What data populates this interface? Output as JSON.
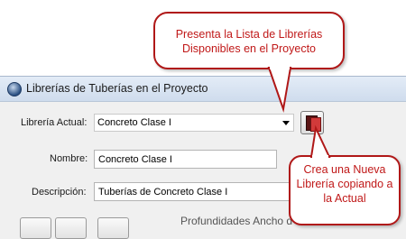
{
  "window": {
    "title": "Librerías de Tuberías en el Proyecto",
    "icon": "app-icon"
  },
  "form": {
    "libreria_actual": {
      "label": "Librería Actual:",
      "selected_value": "Concreto Clase I"
    },
    "nombre": {
      "label": "Nombre:",
      "value": "Concreto Clase I"
    },
    "descripcion": {
      "label": "Descripción:",
      "value": "Tuberías de Concreto Clase I"
    },
    "partial_label": "Profundidades Ancho d"
  },
  "callouts": {
    "dropdown_tip": "Presenta la Lista de Librerías Disponibles en el Proyecto",
    "new_button_tip": "Crea una Nueva Librería copiando a la Actual"
  },
  "colors": {
    "callout_border": "#b01818",
    "callout_text": "#c01818",
    "titlebar": "#dbe6f4",
    "dialog_bg": "#f0f0f0"
  }
}
